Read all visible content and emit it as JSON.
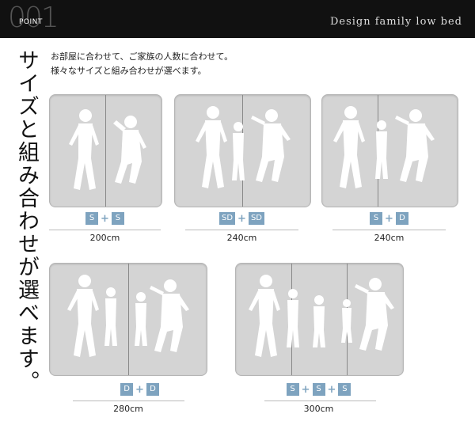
{
  "header": {
    "number": "001",
    "point_label": "POINT",
    "title": "Design family low bed"
  },
  "vertical_title": "サイズと組み合わせが選べます。",
  "intro": {
    "line1": "お部屋に合わせて、ご家族の人数に合わせて。",
    "line2": "様々なサイズと組み合わせが選べます。"
  },
  "options": [
    {
      "parts": [
        "S",
        "S"
      ],
      "size": "200cm"
    },
    {
      "parts": [
        "SD",
        "SD"
      ],
      "size": "240cm"
    },
    {
      "parts": [
        "S",
        "D"
      ],
      "size": "240cm"
    },
    {
      "parts": [
        "D",
        "D"
      ],
      "size": "280cm"
    },
    {
      "parts": [
        "S",
        "S",
        "S"
      ],
      "size": "300cm"
    }
  ],
  "plus_sign": "+",
  "colors": {
    "header_bg": "#111111",
    "bed_fill": "#d4d4d4",
    "chip": "#7ea3bf",
    "silhouette": "#ffffff"
  }
}
